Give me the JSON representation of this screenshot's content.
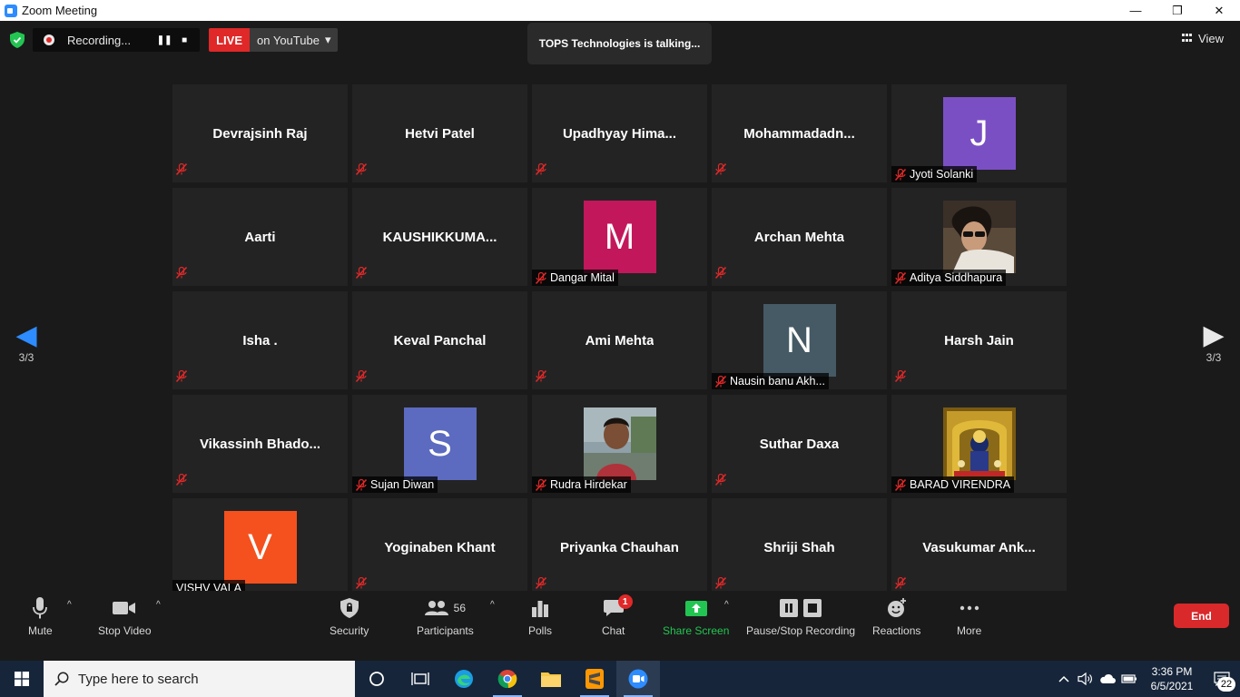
{
  "window": {
    "title": "Zoom Meeting",
    "minimize": "—",
    "restore": "❐",
    "close": "✕"
  },
  "topbar": {
    "recording_label": "Recording...",
    "pause_symbol": "❚❚",
    "stop_symbol": "■",
    "live_badge": "LIVE",
    "live_destination": "on YouTube",
    "dropdown_caret": "▾",
    "talking_text": "TOPS Technologies is talking...",
    "view_label": "View"
  },
  "pagination": {
    "left_arrow": "◀",
    "right_arrow": "▶",
    "left_page": "3/3",
    "right_page": "3/3"
  },
  "participants": [
    {
      "name": "Devrajsinh Raj",
      "kind": "name"
    },
    {
      "name": "Hetvi Patel",
      "kind": "name"
    },
    {
      "name": "Upadhyay  Hima...",
      "kind": "name"
    },
    {
      "name": "Mohammadadn...",
      "kind": "name"
    },
    {
      "name": "Jyoti Solanki",
      "kind": "avatar",
      "letter": "J",
      "color": "#7b4fc4"
    },
    {
      "name": "Aarti",
      "kind": "name"
    },
    {
      "name": "KAUSHIKKUMA...",
      "kind": "name"
    },
    {
      "name": "Dangar Mital",
      "kind": "avatar",
      "letter": "M",
      "color": "#c2185b"
    },
    {
      "name": "Archan Mehta",
      "kind": "name"
    },
    {
      "name": "Aditya Siddhapura",
      "kind": "photo",
      "photo": "person-sunglasses"
    },
    {
      "name": "Isha .",
      "kind": "name"
    },
    {
      "name": "Keval Panchal",
      "kind": "name"
    },
    {
      "name": "Ami Mehta",
      "kind": "name"
    },
    {
      "name": "Nausin banu Akh...",
      "kind": "avatar",
      "letter": "N",
      "color": "#455a64"
    },
    {
      "name": "Harsh Jain",
      "kind": "name"
    },
    {
      "name": "Vikassinh  Bhado...",
      "kind": "name"
    },
    {
      "name": "Sujan Diwan",
      "kind": "avatar",
      "letter": "S",
      "color": "#5c6bc0"
    },
    {
      "name": "Rudra Hirdekar",
      "kind": "photo",
      "photo": "person-outdoor"
    },
    {
      "name": "Suthar Daxa",
      "kind": "name"
    },
    {
      "name": "BARAD VIRENDRA",
      "kind": "photo",
      "photo": "deity-shrine"
    },
    {
      "name": "VISHV VALA",
      "kind": "avatar",
      "letter": "V",
      "color": "#f4511e",
      "unmuted": true
    },
    {
      "name": "Yoginaben Khant",
      "kind": "name"
    },
    {
      "name": "Priyanka Chauhan",
      "kind": "name"
    },
    {
      "name": "Shriji Shah",
      "kind": "name"
    },
    {
      "name": "Vasukumar  Ank...",
      "kind": "name"
    }
  ],
  "toolbar": {
    "mute": "Mute",
    "stop_video": "Stop Video",
    "security": "Security",
    "participants": "Participants",
    "participants_count": "56",
    "polls": "Polls",
    "chat": "Chat",
    "chat_badge": "1",
    "share_screen": "Share Screen",
    "pause_stop_recording": "Pause/Stop Recording",
    "reactions": "Reactions",
    "more": "More",
    "end": "End",
    "caret": "^"
  },
  "taskbar": {
    "search_placeholder": "Type here to search",
    "time": "3:36 PM",
    "date": "6/5/2021",
    "notification_count": "22"
  },
  "colors": {
    "accent_blue": "#2d8cff",
    "live_red": "#e02828",
    "share_green": "#23c552",
    "end_red": "#d9292b"
  }
}
